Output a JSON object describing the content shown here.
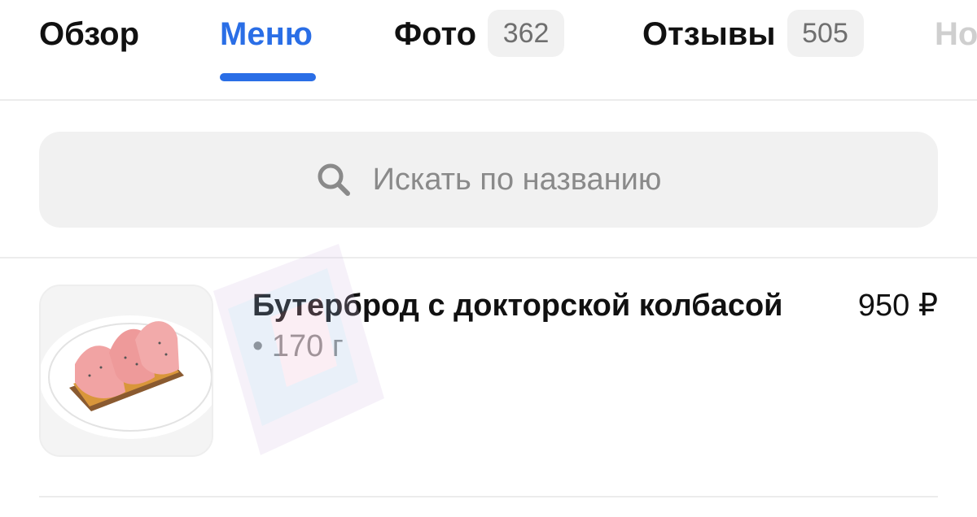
{
  "tabs": [
    {
      "label": "Обзор"
    },
    {
      "label": "Меню",
      "active": true
    },
    {
      "label": "Фото",
      "count": "362"
    },
    {
      "label": "Отзывы",
      "count": "505"
    },
    {
      "label": "Но"
    }
  ],
  "search": {
    "placeholder": "Искать по названию",
    "icon": "search-icon"
  },
  "menu_items": [
    {
      "name": "Бутерброд с докторской колбасой",
      "weight": "• 170 г",
      "price": "950 ₽"
    }
  ],
  "colors": {
    "accent": "#2a6ee6",
    "badge_bg": "#f1f1f1",
    "muted_text": "#8a8a8a"
  }
}
